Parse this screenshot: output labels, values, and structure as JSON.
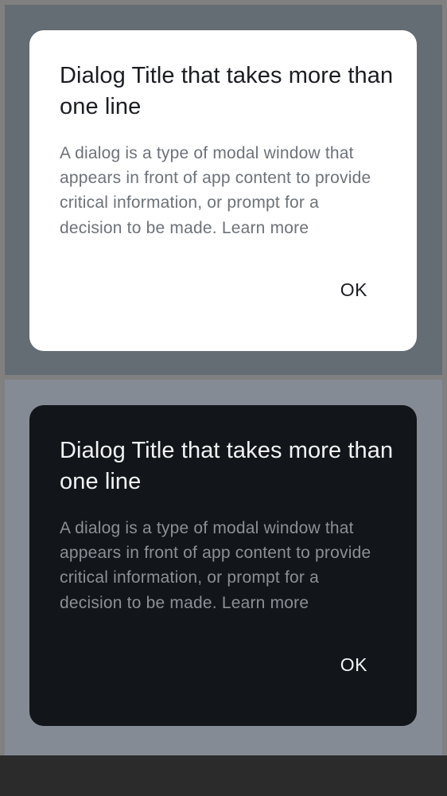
{
  "colors": {
    "light_scrim": "#646c74",
    "dark_scrim": "#858b94",
    "light_surface": "#ffffff",
    "dark_surface": "#121519",
    "bottom_bar": "#2b2b2b"
  },
  "dialogs": [
    {
      "theme": "light",
      "title": "Dialog Title that takes more than one line",
      "body": "A dialog is a type of modal window that appears in front of app content to provide critical information, or prompt for a decision to be made. Learn more",
      "action_label": "OK"
    },
    {
      "theme": "dark",
      "title": "Dialog Title that takes more than one line",
      "body": "A dialog is a type of modal window that appears in front of app content to provide critical information, or prompt for a decision to be made. Learn more",
      "action_label": "OK"
    }
  ]
}
